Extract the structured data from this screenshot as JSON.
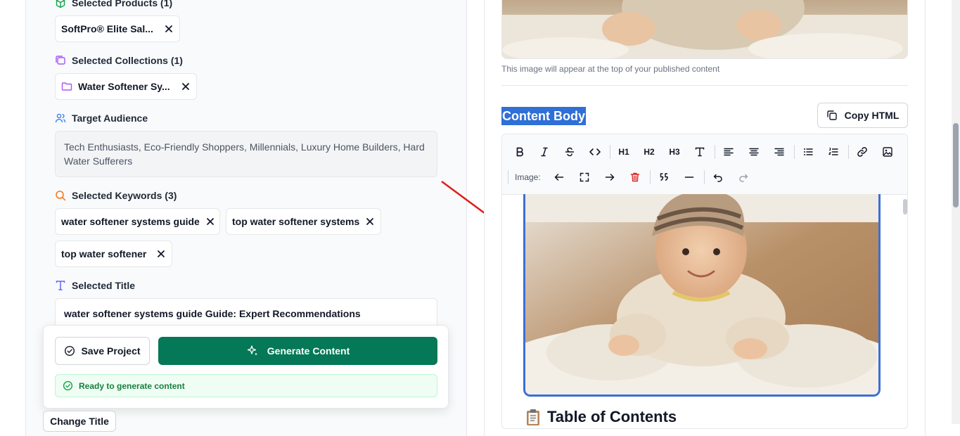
{
  "left": {
    "selected_products": {
      "label": "Selected Products (1)",
      "items": [
        "SoftPro® Elite Sal..."
      ]
    },
    "selected_collections": {
      "label": "Selected Collections (1)",
      "items": [
        "Water Softener Sy..."
      ]
    },
    "target_audience": {
      "label": "Target Audience",
      "value": "Tech Enthusiasts, Eco-Friendly Shoppers, Millennials, Luxury Home Builders, Hard Water Sufferers"
    },
    "selected_keywords": {
      "label": "Selected Keywords (3)",
      "items": [
        "water softener systems guide",
        "top water softener systems",
        "top water softener"
      ]
    },
    "selected_title": {
      "label": "Selected Title",
      "value": "water softener systems guide Guide: Expert Recommendations"
    },
    "actions": {
      "save_label": "Save Project",
      "generate_label": "Generate Content",
      "status_text": "Ready to generate content",
      "change_title_label": "Change Title"
    }
  },
  "right": {
    "featured_image_hint": "This image will appear at the top of your published content",
    "content_body_label": "Content Body",
    "copy_html_label": "Copy HTML",
    "toolbar": {
      "h1": "H1",
      "h2": "H2",
      "h3": "H3",
      "image_label": "Image:"
    },
    "toc_heading": "Table of Contents"
  },
  "colors": {
    "primary_green": "#047857",
    "status_green_bg": "#f0fdf4",
    "highlight_blue": "#2f6fd6",
    "image_border_blue": "#3b6fd8",
    "arrow_red": "#e11d1d",
    "delete_red": "#dc2626"
  }
}
